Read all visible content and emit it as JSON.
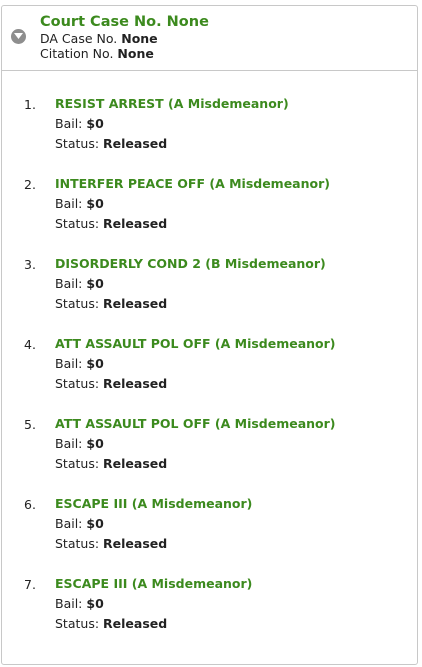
{
  "header": {
    "title": "Court Case No. None",
    "da_label": "DA Case No.",
    "da_value": "None",
    "citation_label": "Citation No.",
    "citation_value": "None"
  },
  "labels": {
    "bail": "Bail:",
    "status": "Status:"
  },
  "charges": [
    {
      "num": "1.",
      "name": "RESIST ARREST (A Misdemeanor)",
      "bail": "$0",
      "status": "Released"
    },
    {
      "num": "2.",
      "name": "INTERFER PEACE OFF (A Misdemeanor)",
      "bail": "$0",
      "status": "Released"
    },
    {
      "num": "3.",
      "name": "DISORDERLY COND 2 (B Misdemeanor)",
      "bail": "$0",
      "status": "Released"
    },
    {
      "num": "4.",
      "name": "ATT ASSAULT POL OFF (A Misdemeanor)",
      "bail": "$0",
      "status": "Released"
    },
    {
      "num": "5.",
      "name": "ATT ASSAULT POL OFF (A Misdemeanor)",
      "bail": "$0",
      "status": "Released"
    },
    {
      "num": "6.",
      "name": "ESCAPE III (A Misdemeanor)",
      "bail": "$0",
      "status": "Released"
    },
    {
      "num": "7.",
      "name": "ESCAPE III (A Misdemeanor)",
      "bail": "$0",
      "status": "Released"
    }
  ]
}
